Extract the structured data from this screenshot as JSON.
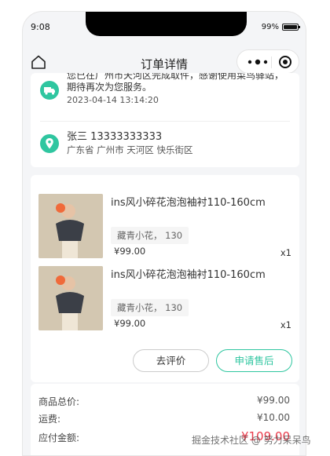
{
  "status_bar": {
    "time": "9:08",
    "battery": "99%",
    "battery_level": 0.99
  },
  "navbar": {
    "title": "订单详情"
  },
  "logistics": {
    "message": "您已在广州市天河区完成取件，感谢使用菜鸟驿站，期待再次为您服务。",
    "time": "2023-04-14 13:14:20",
    "icon": "truck-icon"
  },
  "address": {
    "name_phone": "张三 13333333333",
    "detail": "广东省 广州市 天河区 快乐街区",
    "icon": "location-pin-icon"
  },
  "goods": [
    {
      "title": "ins风小碎花泡泡袖衬110-160cm",
      "spec": "藏青小花， 130",
      "price": "¥99.00",
      "qty": "x1"
    },
    {
      "title": "ins风小碎花泡泡袖衬110-160cm",
      "spec": "藏青小花， 130",
      "price": "¥99.00",
      "qty": "x1"
    }
  ],
  "actions": {
    "review": "去评价",
    "after_sale": "申请售后"
  },
  "summary": {
    "goods_total_label": "商品总价:",
    "goods_total": "¥99.00",
    "shipping_label": "运费:",
    "shipping": "¥10.00",
    "payable_label": "应付金额:",
    "payable": "¥109.00"
  },
  "watermark": "掘金技术社区 @ 努力呆呆鸟",
  "colors": {
    "accent": "#2fc6a0",
    "price_red": "#e93b4b"
  }
}
